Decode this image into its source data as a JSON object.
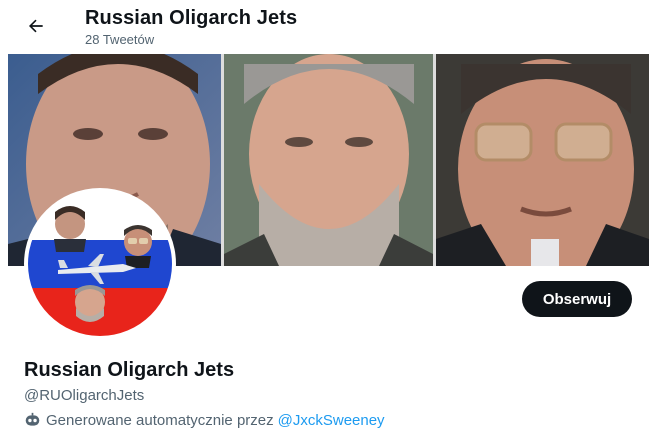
{
  "header": {
    "title": "Russian Oligarch Jets",
    "tweet_count": "28 Tweetów"
  },
  "profile": {
    "name": "Russian Oligarch Jets",
    "handle": "@RUOligarchJets",
    "follow_label": "Obserwuj",
    "bio_prefix": "Generowane automatycznie przez",
    "bio_link": "@JxckSweeney",
    "bio_icon": "bot-icon"
  },
  "colors": {
    "link": "#1d9bf0",
    "muted": "#536471",
    "button_bg": "#0f1419"
  }
}
